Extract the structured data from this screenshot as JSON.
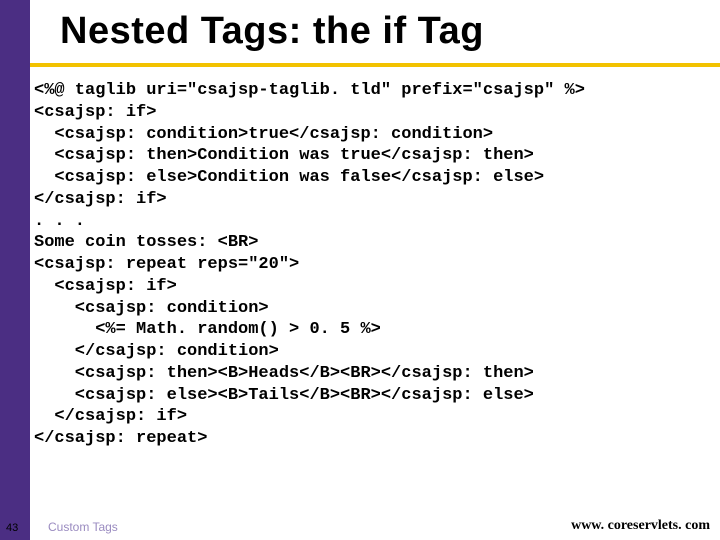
{
  "title": "Nested Tags: the if Tag",
  "code": "<%@ taglib uri=\"csajsp-taglib. tld\" prefix=\"csajsp\" %>\n<csajsp: if>\n  <csajsp: condition>true</csajsp: condition>\n  <csajsp: then>Condition was true</csajsp: then>\n  <csajsp: else>Condition was false</csajsp: else>\n</csajsp: if>\n. . .\nSome coin tosses: <BR>\n<csajsp: repeat reps=\"20\">\n  <csajsp: if>\n    <csajsp: condition>\n      <%= Math. random() > 0. 5 %>\n    </csajsp: condition>\n    <csajsp: then><B>Heads</B><BR></csajsp: then>\n    <csajsp: else><B>Tails</B><BR></csajsp: else>\n  </csajsp: if>\n</csajsp: repeat>",
  "footer": {
    "page_number": "43",
    "label": "Custom Tags",
    "url": "www. coreservlets. com"
  }
}
